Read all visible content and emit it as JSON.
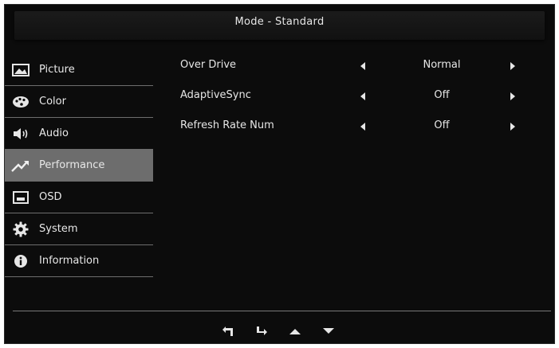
{
  "header": {
    "title": "Mode - Standard"
  },
  "sidebar": {
    "items": [
      {
        "label": "Picture",
        "icon": "picture-icon"
      },
      {
        "label": "Color",
        "icon": "palette-icon"
      },
      {
        "label": "Audio",
        "icon": "speaker-icon"
      },
      {
        "label": "Performance",
        "icon": "performance-icon",
        "active": true
      },
      {
        "label": "OSD",
        "icon": "osd-icon"
      },
      {
        "label": "System",
        "icon": "gear-icon"
      },
      {
        "label": "Information",
        "icon": "info-icon"
      }
    ]
  },
  "settings": {
    "rows": [
      {
        "label": "Over Drive",
        "value": "Normal"
      },
      {
        "label": "AdaptiveSync",
        "value": "Off"
      },
      {
        "label": "Refresh Rate Num",
        "value": "Off"
      }
    ]
  },
  "navbar": {
    "buttons": [
      "back-icon",
      "enter-icon",
      "up-arrow-icon",
      "down-arrow-icon"
    ]
  },
  "colors": {
    "background": "#0c0c0c",
    "active": "#6d6d6d",
    "text": "#e6e6e6",
    "divider": "#6e6e6e"
  }
}
